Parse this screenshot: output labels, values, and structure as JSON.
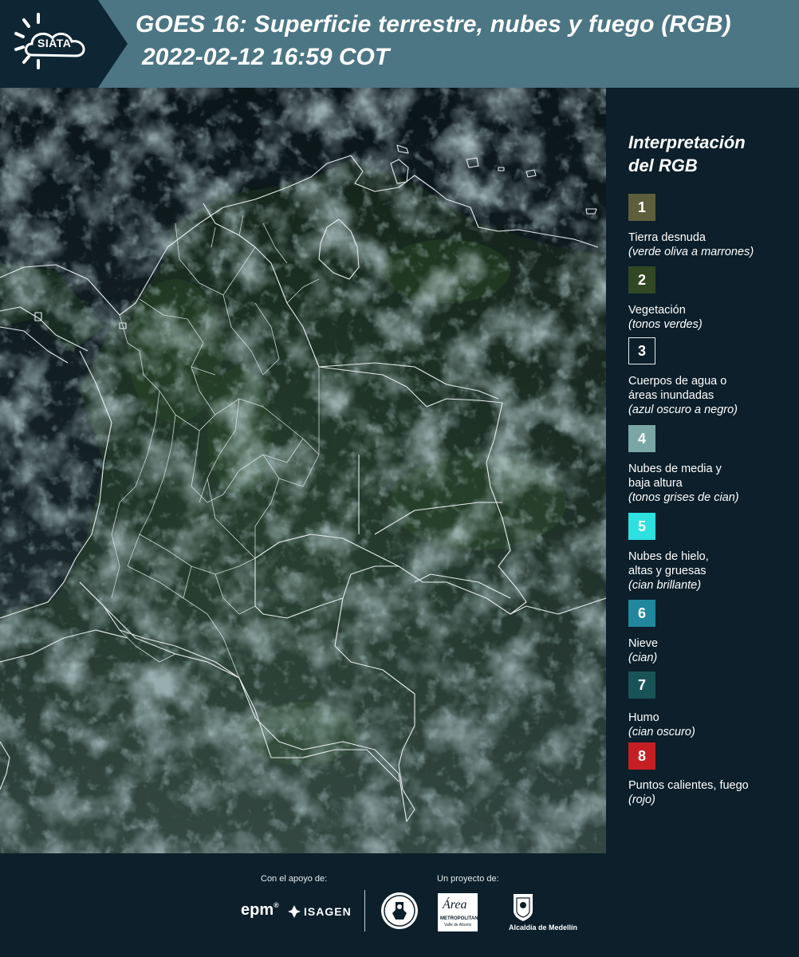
{
  "header": {
    "logo_text": "SIATA",
    "title_line1": "GOES 16: Superficie terrestre, nubes y fuego (RGB)",
    "title_line2": "2022-02-12 16:59 COT"
  },
  "legend": {
    "title_line1": "Interpretación",
    "title_line2": "del RGB",
    "items": [
      {
        "number": "1",
        "color": "#5d5f3c",
        "text": "Tierra desnuda",
        "desc": "(verde oliva a marrones)"
      },
      {
        "number": "2",
        "color": "#324824",
        "text": "Vegetación",
        "desc": "(tonos verdes)"
      },
      {
        "number": "3",
        "color": "#0c1f2b",
        "text": "Cuerpos de agua o",
        "text2": "áreas inundadas",
        "desc": "(azul oscuro a negro)"
      },
      {
        "number": "4",
        "color": "#7aa7a6",
        "text": "Nubes de media y",
        "text2": "baja altura",
        "desc": "(tonos grises de cian)"
      },
      {
        "number": "5",
        "color": "#2ee0e0",
        "text": "Nubes de hielo,",
        "text2": "altas y gruesas",
        "desc": "(cian brillante)"
      },
      {
        "number": "6",
        "color": "#20879d",
        "text": "Nieve",
        "desc": "(cian)"
      },
      {
        "number": "7",
        "color": "#195357",
        "text": "Humo",
        "desc": "(cian oscuro)"
      },
      {
        "number": "8",
        "color": "#c51f23",
        "text": "Puntos calientes, fuego",
        "desc": "(rojo)"
      }
    ]
  },
  "footer": {
    "support_label": "Con el apoyo de:",
    "project_label": "Un proyecto de:",
    "sponsor_epm": "epm",
    "sponsor_isagen": "ISAGEN",
    "area_main": "Área",
    "area_sub1": "METROPOLITANA",
    "area_sub2": "Valle de Aburrá",
    "alcaldia": "Alcaldía de Medellín"
  }
}
